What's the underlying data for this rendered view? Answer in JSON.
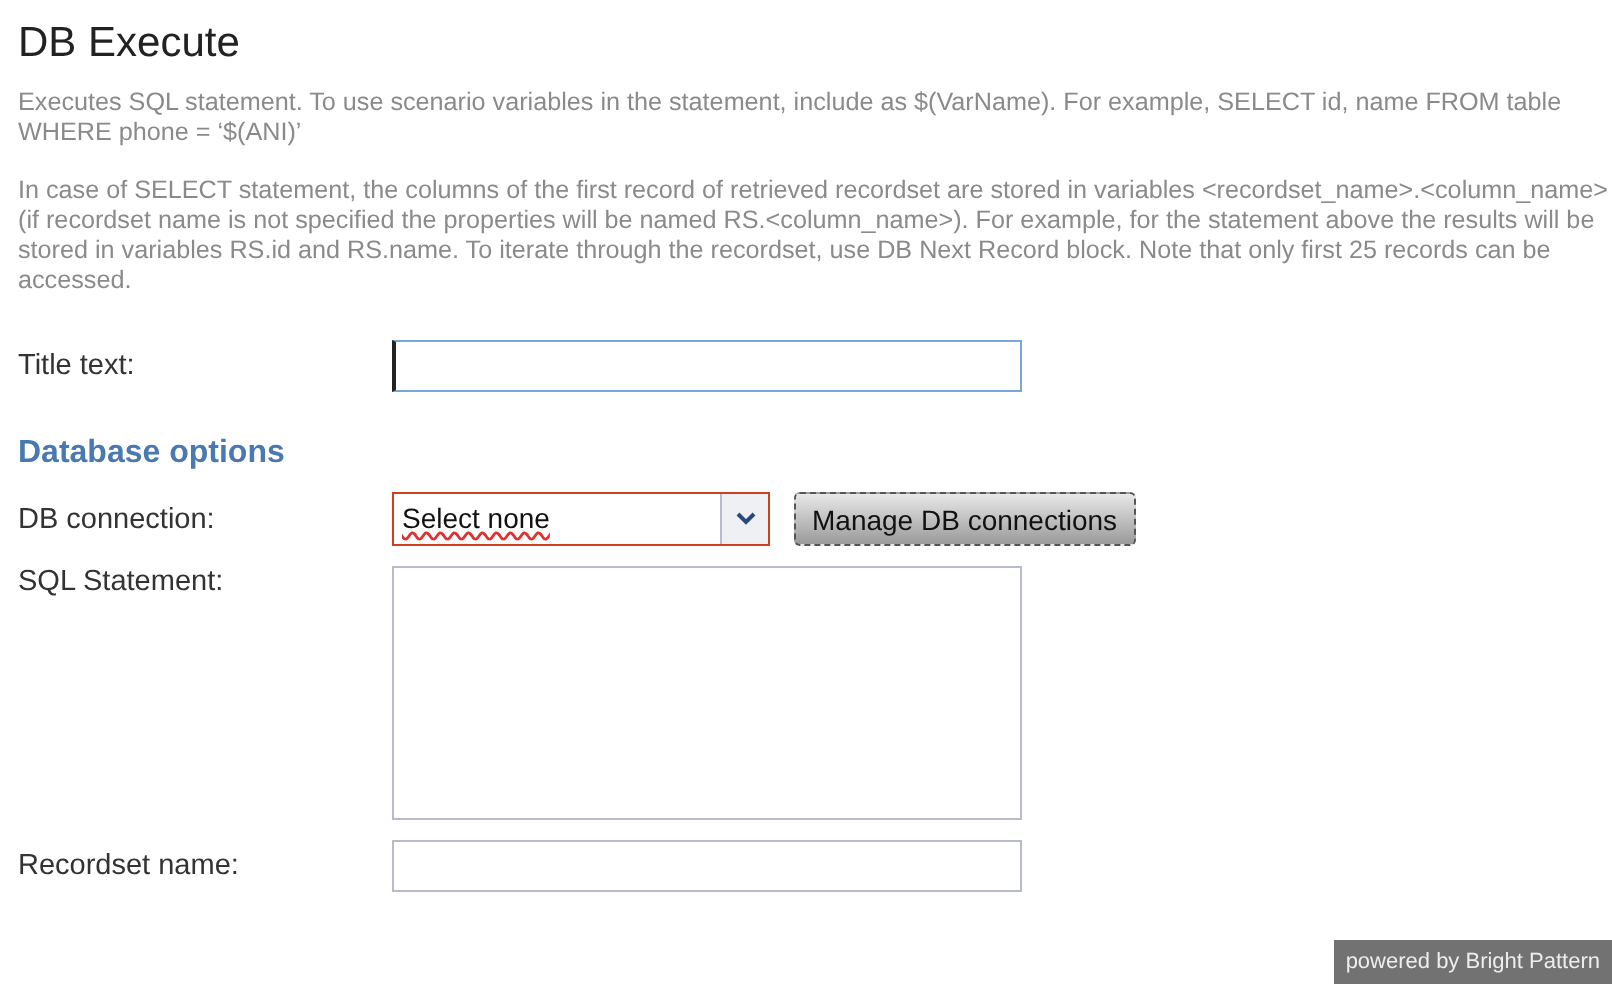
{
  "title": "DB Execute",
  "description": [
    "Executes SQL statement. To use scenario variables in the statement, include as $(VarName). For example, SELECT id, name FROM table WHERE phone = ‘$(ANI)’",
    "In case of SELECT statement, the columns of the first record of retrieved recordset are stored in variables <recordset_name>.<column_name> (if recordset name is not specified the properties will be named RS.<column_name>). For example, for the statement above the results will be stored in variables RS.id and RS.name. To iterate through the recordset, use DB Next Record block. Note that only first 25 records can be accessed."
  ],
  "title_field": {
    "label": "Title text:",
    "focused": true
  },
  "section": "Database options",
  "db_connection": {
    "label": "DB connection:",
    "value": "Select none",
    "invalid": true,
    "button": "Manage DB connections"
  },
  "sql_statement": {
    "label": "SQL Statement:"
  },
  "recordset_name": {
    "label": "Recordset name:"
  },
  "badge": "powered by Bright Pattern"
}
